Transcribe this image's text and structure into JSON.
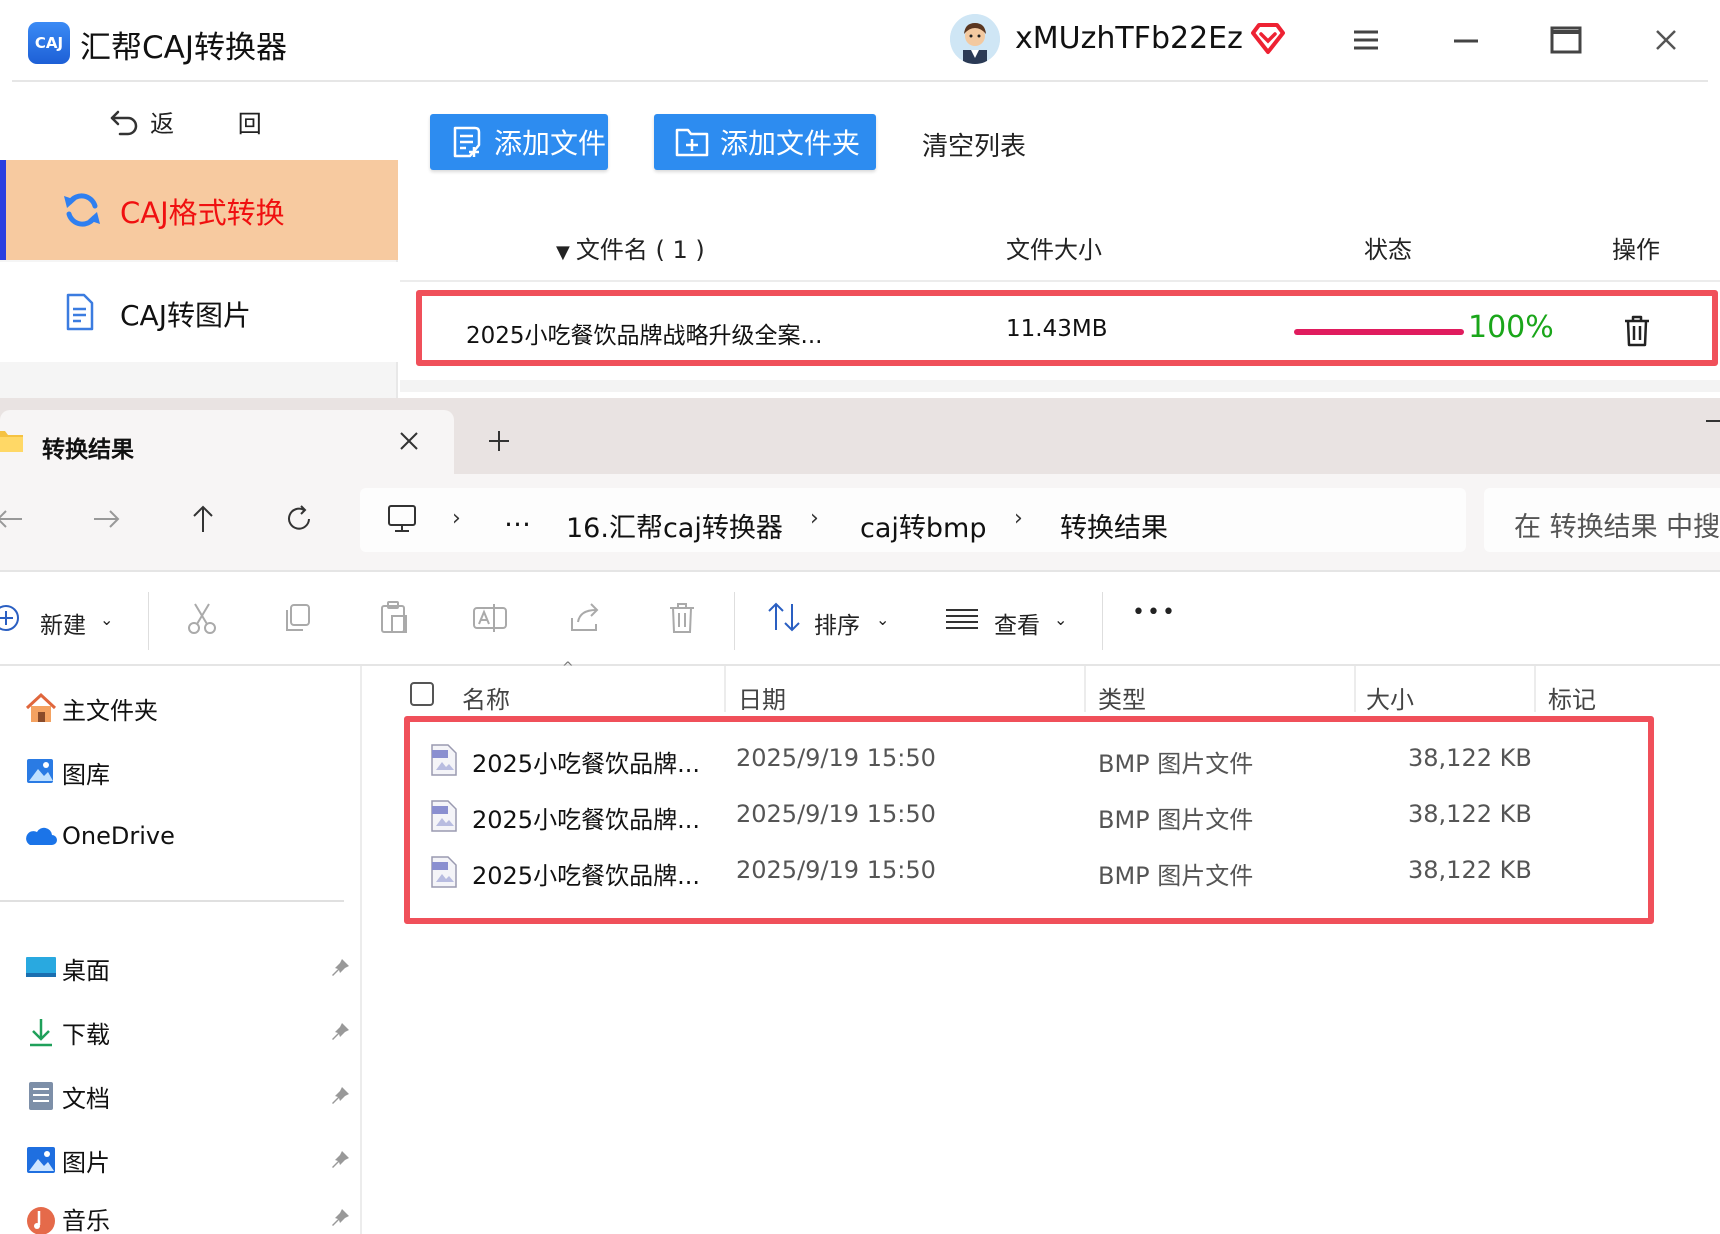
{
  "app": {
    "logo_text": "CAJ",
    "title": "汇帮CAJ转换器",
    "username": "xMUzhTFb22Ez",
    "back_label": "返 回",
    "nav": [
      {
        "label": "CAJ格式转换"
      },
      {
        "label": "CAJ转图片"
      }
    ],
    "buttons": {
      "add_file": "添加文件",
      "add_folder": "添加文件夹",
      "clear_list": "清空列表"
    },
    "columns": {
      "name": "文件名 ( 1 )",
      "size": "文件大小",
      "status": "状态",
      "action": "操作"
    },
    "file": {
      "name": "2025小吃餐饮品牌战略升级全案...",
      "size": "11.43MB",
      "progress_text": "100%",
      "progress": 1.0
    },
    "colors": {
      "accent_blue": "#2d8cf0",
      "selected_bg": "#f7caa0",
      "selected_text": "#f01010",
      "progress_bar": "#e01c5e",
      "progress_text": "#1aa61a",
      "highlight_box": "#f0505a"
    }
  },
  "explorer": {
    "tab_title": "转换结果",
    "breadcrumbs": [
      "…",
      "16.汇帮caj转换器",
      "caj转bmp",
      "转换结果"
    ],
    "search_placeholder": "在 转换结果 中搜",
    "toolbar": {
      "new_label": "新建",
      "sort_label": "排序",
      "view_label": "查看",
      "more_label": "•••"
    },
    "nav_items": [
      {
        "label": "主文件夹",
        "icon": "home-icon"
      },
      {
        "label": "图库",
        "icon": "gallery-icon"
      },
      {
        "label": "OneDrive",
        "icon": "cloud-icon"
      }
    ],
    "quick_access": [
      {
        "label": "桌面",
        "icon": "desktop-icon"
      },
      {
        "label": "下载",
        "icon": "download-icon"
      },
      {
        "label": "文档",
        "icon": "document-icon"
      },
      {
        "label": "图片",
        "icon": "pictures-icon"
      },
      {
        "label": "音乐",
        "icon": "music-icon"
      }
    ],
    "columns": {
      "name": "名称",
      "date": "日期",
      "type": "类型",
      "size": "大小",
      "tag": "标记"
    },
    "files": [
      {
        "name": "2025小吃餐饮品牌...",
        "date": "2025/9/19 15:50",
        "type": "BMP 图片文件",
        "size": "38,122 KB"
      },
      {
        "name": "2025小吃餐饮品牌...",
        "date": "2025/9/19 15:50",
        "type": "BMP 图片文件",
        "size": "38,122 KB"
      },
      {
        "name": "2025小吃餐饮品牌...",
        "date": "2025/9/19 15:50",
        "type": "BMP 图片文件",
        "size": "38,122 KB"
      }
    ]
  }
}
